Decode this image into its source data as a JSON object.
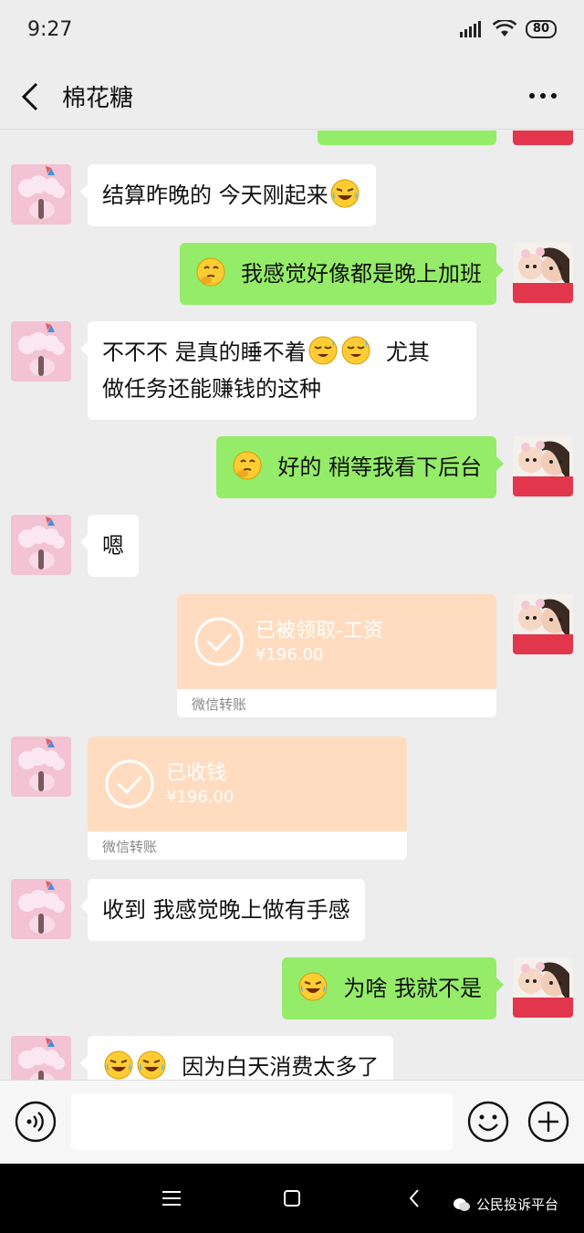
{
  "status": {
    "time": "9:27",
    "battery": "80"
  },
  "header": {
    "title": "棉花糖"
  },
  "messages": [
    {
      "side": "left",
      "text": "结算昨晚的  今天刚起来",
      "emoji": "laughing-crying-emoji"
    },
    {
      "side": "right",
      "text": "我感觉好像都是晚上加班",
      "emoji": "thinking-emoji"
    },
    {
      "side": "left",
      "line1": "不不不  是真的睡不着",
      "line1_tail": "尤其",
      "line2": "做任务还能赚钱的这种",
      "emoji": "sleepy-laugh-emoji"
    },
    {
      "side": "right",
      "text": "好的  稍等我看下后台",
      "emoji": "thinking-emoji"
    },
    {
      "side": "left",
      "text": "嗯"
    },
    {
      "side": "right",
      "type": "transfer",
      "title": "已被领取-工资",
      "amount": "¥196.00",
      "footer": "微信转账"
    },
    {
      "side": "left",
      "type": "transfer",
      "title": "已收钱",
      "amount": "¥196.00",
      "footer": "微信转账"
    },
    {
      "side": "left",
      "text": "收到  我感觉晚上做有手感"
    },
    {
      "side": "right",
      "text": "为啥  我就不是",
      "emoji": "laughing-crying-emoji"
    },
    {
      "side": "left",
      "text": "因为白天消费太多了",
      "emoji": "laughing-crying-emoji"
    }
  ],
  "input": {
    "placeholder": ""
  },
  "watermark": {
    "text": "公民投诉平台"
  },
  "colors": {
    "self_bubble": "#95ec69",
    "other_bubble": "#ffffff",
    "transfer_card": "#ffdcc0"
  }
}
